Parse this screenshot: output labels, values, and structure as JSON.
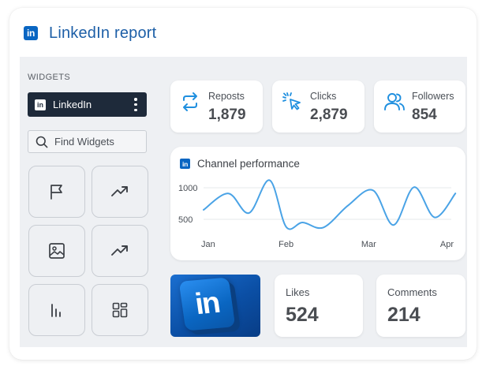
{
  "report": {
    "title": "LinkedIn report"
  },
  "sidebar": {
    "heading": "WIDGETS",
    "selected_item": "LinkedIn",
    "search_placeholder": "Find Widgets",
    "tiles": [
      {
        "icon": "flag-icon"
      },
      {
        "icon": "trending-up-icon"
      },
      {
        "icon": "image-icon"
      },
      {
        "icon": "trending-up-icon"
      },
      {
        "icon": "bar-chart-icon"
      },
      {
        "icon": "dashboard-grid-icon"
      }
    ]
  },
  "stats": [
    {
      "label": "Reposts",
      "value": "1,879",
      "icon": "repost-icon"
    },
    {
      "label": "Clicks",
      "value": "2,879",
      "icon": "cursor-click-icon"
    },
    {
      "label": "Followers",
      "value": "854",
      "icon": "followers-icon"
    }
  ],
  "chart_data": {
    "type": "line",
    "title": "Channel performance",
    "categories": [
      "Jan",
      "Feb",
      "Mar",
      "Apr"
    ],
    "y_ticks": [
      "1000",
      "500"
    ],
    "ylim": [
      300,
      1150
    ],
    "x": [
      0,
      0.3,
      0.55,
      0.8,
      1.0,
      1.2,
      1.45,
      1.75,
      2.05,
      2.3,
      2.55,
      2.8,
      3.05
    ],
    "values": [
      650,
      910,
      600,
      1120,
      380,
      450,
      370,
      720,
      960,
      410,
      1010,
      530,
      910
    ],
    "series_color": "#4aa3e6",
    "grid": true
  },
  "engagement": [
    {
      "label": "Likes",
      "value": "524"
    },
    {
      "label": "Comments",
      "value": "214"
    }
  ],
  "colors": {
    "linkedin_blue": "#0a66c2",
    "accent": "#1f8fdf",
    "dark_item": "#1e2a3a"
  }
}
